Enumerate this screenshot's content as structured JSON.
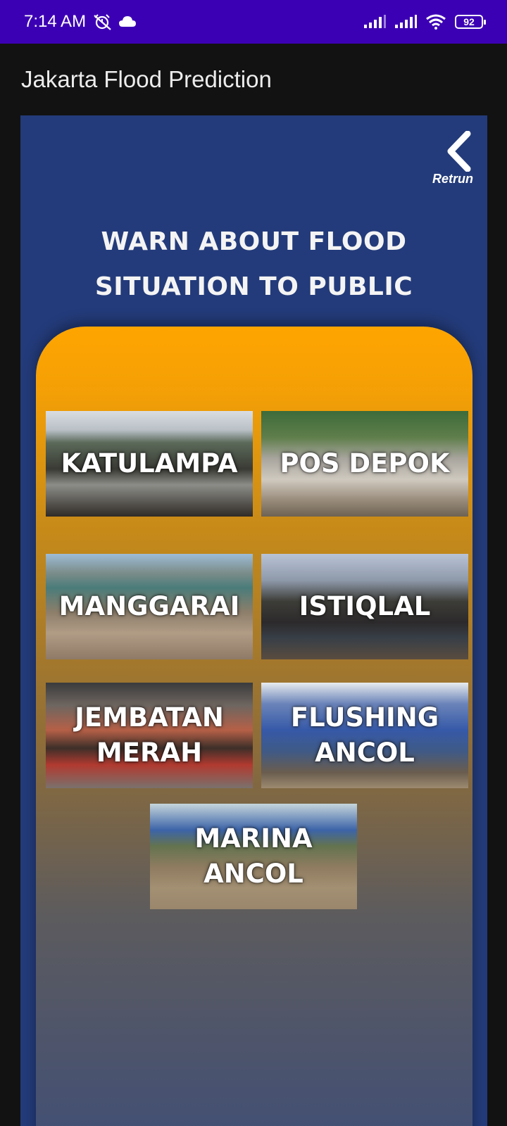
{
  "status_bar": {
    "time": "7:14 AM",
    "battery": "92",
    "icons": [
      "alarm-off-icon",
      "cloud-icon",
      "signal-icon",
      "signal-icon",
      "wifi-icon",
      "battery-icon"
    ]
  },
  "app_bar": {
    "title": "Jakarta Flood Prediction"
  },
  "panel": {
    "back_label": "Retrun",
    "headline_line1": "WARN ABOUT FLOOD",
    "headline_line2": "SITUATION TO PUBLIC"
  },
  "locations": [
    {
      "label": "KATULAMPA"
    },
    {
      "label": "POS DEPOK"
    },
    {
      "label": "MANGGARAI"
    },
    {
      "label": "ISTIQLAL"
    },
    {
      "label": "JEMBATAN\nMERAH"
    },
    {
      "label": "FLUSHING\nANCOL"
    },
    {
      "label": "MARINA\nANCOL"
    }
  ],
  "colors": {
    "status_bar": "#3c00b4",
    "panel": "#233b7a",
    "card_top": "#ffa500",
    "card_bottom": "#3f4e78"
  }
}
